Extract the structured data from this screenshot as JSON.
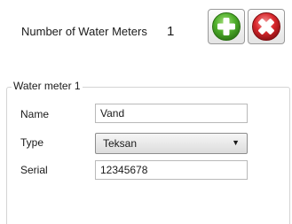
{
  "header": {
    "count_label": "Number of Water Meters",
    "count_value": "1",
    "add_icon": "plus-circle-icon",
    "remove_icon": "x-circle-icon"
  },
  "group": {
    "title": "Water meter 1",
    "fields": {
      "name_label": "Name",
      "name_value": "Vand",
      "type_label": "Type",
      "type_value": "Teksan",
      "serial_label": "Serial",
      "serial_value": "12345678"
    }
  },
  "colors": {
    "add_green": "#4fae2b",
    "remove_red": "#d9272c"
  }
}
